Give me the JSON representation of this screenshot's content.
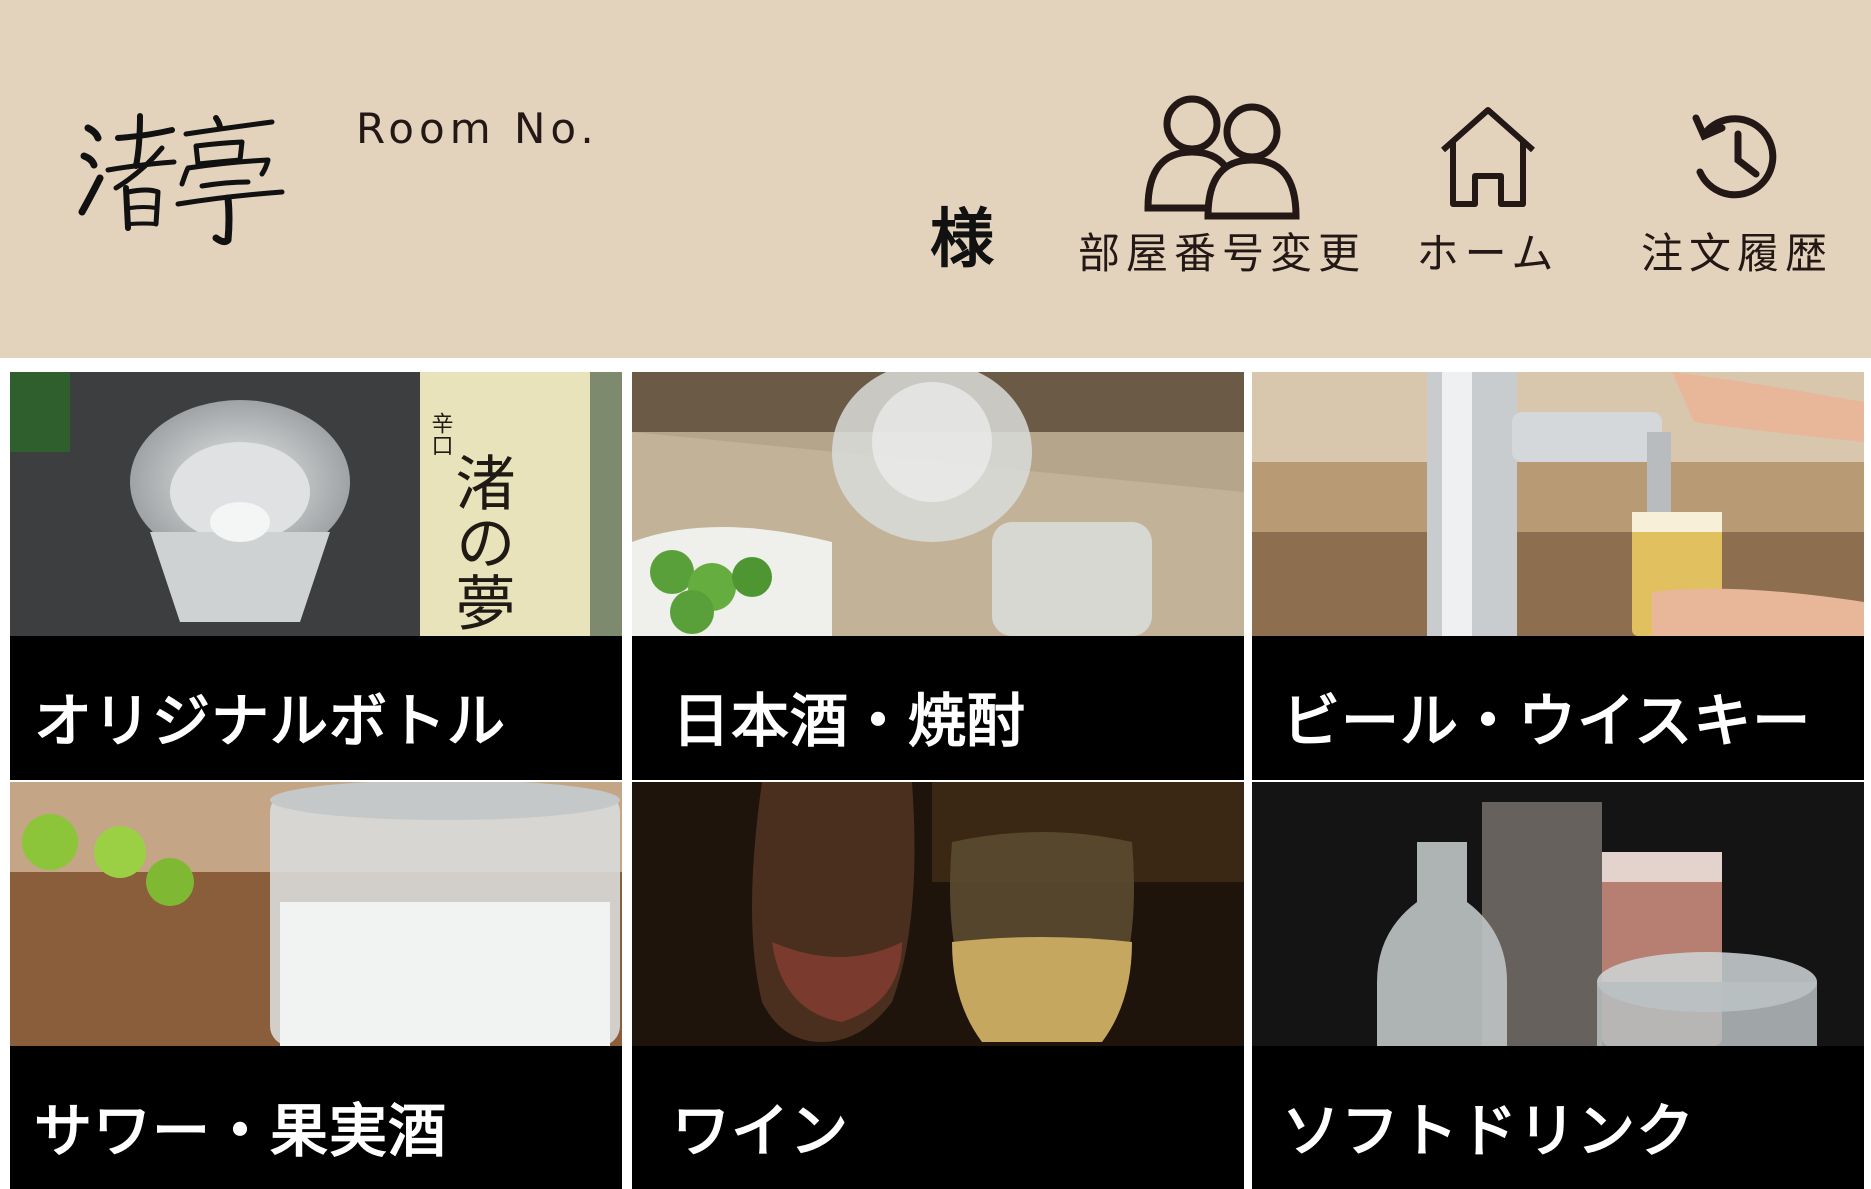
{
  "header": {
    "logo_text": "渚亭",
    "room_label": "Room No.",
    "room_number": "",
    "honorific": "様",
    "nav": [
      {
        "label": "部屋番号変更",
        "icon": "users-icon"
      },
      {
        "label": "ホーム",
        "icon": "home-icon"
      },
      {
        "label": "注文履歴",
        "icon": "history-icon"
      }
    ]
  },
  "categories": [
    {
      "label": "オリジナルボトル",
      "image": "sake-glass-and-bottle-photo",
      "bottle_label": "渚の夢",
      "bottle_sub": "辛口"
    },
    {
      "label": "日本酒・焼酎",
      "image": "sake-carafe-photo"
    },
    {
      "label": "ビール・ウイスキー",
      "image": "beer-tap-photo"
    },
    {
      "label": "サワー・果実酒",
      "image": "sour-glass-photo"
    },
    {
      "label": "ワイン",
      "image": "wine-glasses-photo"
    },
    {
      "label": "ソフトドリンク",
      "image": "soft-drinks-photo"
    }
  ],
  "colors": {
    "header_bg": "#e3d3bd",
    "caption_bg": "#000000",
    "caption_text": "#ffffff",
    "text_dark": "#231815"
  }
}
